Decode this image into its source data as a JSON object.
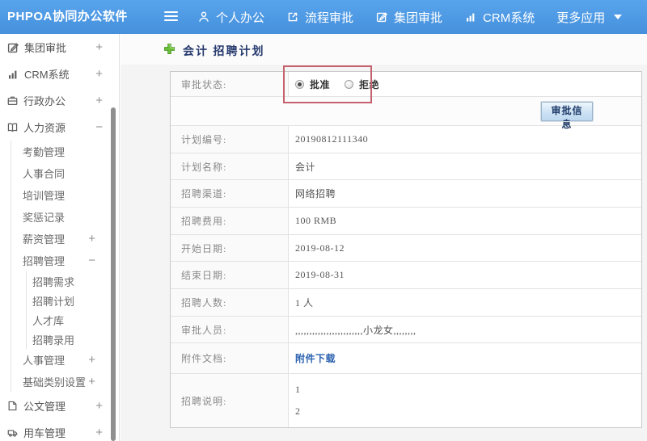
{
  "topbar": {
    "logo": "PHPOA协同办公软件",
    "nav": [
      {
        "label": "个人办公",
        "icon": "person-icon"
      },
      {
        "label": "流程审批",
        "icon": "process-icon"
      },
      {
        "label": "集团审批",
        "icon": "edit-square-icon"
      },
      {
        "label": "CRM系统",
        "icon": "bar-chart-icon"
      },
      {
        "label": "更多应用",
        "icon": "caret-down-icon",
        "caret": true
      }
    ]
  },
  "sidebar": {
    "items": [
      {
        "label": "集团审批",
        "icon": "edit-square-icon",
        "level": 1,
        "expand": "+"
      },
      {
        "label": "CRM系统",
        "icon": "bar-chart-icon",
        "level": 1,
        "expand": "+"
      },
      {
        "label": "行政办公",
        "icon": "briefcase-icon",
        "level": 1,
        "expand": "+"
      },
      {
        "label": "人力资源",
        "icon": "book-icon",
        "level": 1,
        "expand": "-"
      },
      {
        "label": "考勤管理",
        "level": 2
      },
      {
        "label": "人事合同",
        "level": 2
      },
      {
        "label": "培训管理",
        "level": 2
      },
      {
        "label": "奖惩记录",
        "level": 2
      },
      {
        "label": "薪资管理",
        "level": 2,
        "expand": "+"
      },
      {
        "label": "招聘管理",
        "level": 2,
        "expand": "-"
      },
      {
        "label": "招聘需求",
        "level": 3
      },
      {
        "label": "招聘计划",
        "level": 3,
        "active": true
      },
      {
        "label": "人才库",
        "level": 3
      },
      {
        "label": "招聘录用",
        "level": 3
      },
      {
        "label": "人事管理",
        "level": 2,
        "expand": "+"
      },
      {
        "label": "基础类别设置",
        "level": 2,
        "expand": "+"
      },
      {
        "label": "公文管理",
        "icon": "document-icon",
        "level": 1,
        "expand": "+"
      },
      {
        "label": "用车管理",
        "icon": "car-icon",
        "level": 1,
        "expand": "+"
      }
    ]
  },
  "main": {
    "title": "会计 招聘计划",
    "form": {
      "status": {
        "label": "审批状态:",
        "options": [
          {
            "label": "批准",
            "selected": true
          },
          {
            "label": "拒绝",
            "selected": false
          }
        ]
      },
      "approve_info_button": "审批信息",
      "rows": [
        {
          "label": "计划编号:",
          "value": "20190812111340"
        },
        {
          "label": "计划名称:",
          "value": "会计"
        },
        {
          "label": "招聘渠道:",
          "value": "网络招聘"
        },
        {
          "label": "招聘费用:",
          "value": "100 RMB"
        },
        {
          "label": "开始日期:",
          "value": "2019-08-12"
        },
        {
          "label": "结束日期:",
          "value": "2019-08-31"
        },
        {
          "label": "招聘人数:",
          "value": "1 人"
        },
        {
          "label": "审批人员:",
          "value": ",,,,,,,,,,,,,,,,,,,,,,,,小龙女,,,,,,,,"
        },
        {
          "label": "附件文档:",
          "value": "附件下载",
          "type": "link"
        },
        {
          "label": "招聘说明:",
          "type": "multiline",
          "lines": [
            "1",
            "2"
          ]
        }
      ]
    }
  },
  "colors": {
    "topbar_blue": "#4a96e0",
    "annotation_red": "#c4616d",
    "link_blue": "#2e64b1",
    "title_navy": "#263a6e"
  }
}
